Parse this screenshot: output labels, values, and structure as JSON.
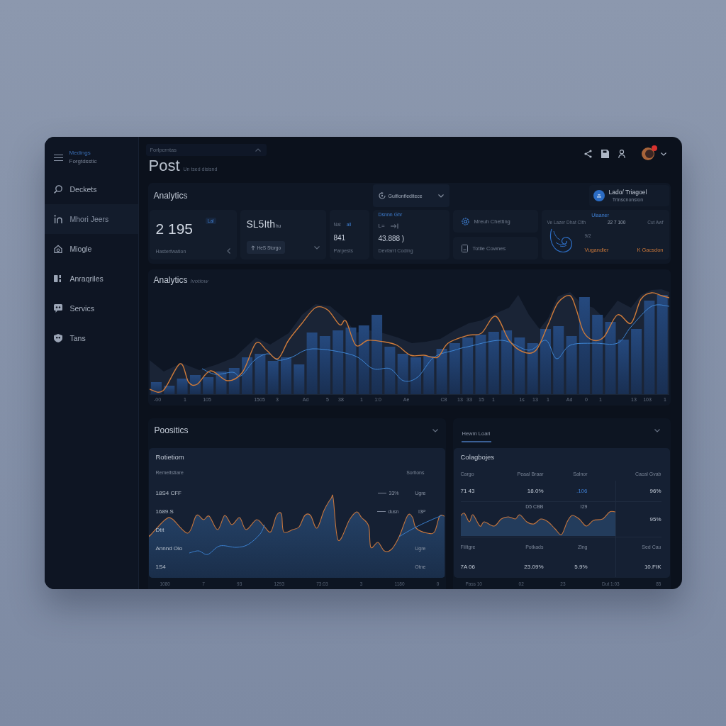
{
  "sidebar": {
    "brand": {
      "title": "Medings",
      "subtitle": "Forgtdsstic"
    },
    "items": [
      {
        "label": "Deckets",
        "selected": false
      },
      {
        "label": "Mhori Jeers",
        "selected": true
      },
      {
        "label": "Miogle",
        "selected": false
      },
      {
        "label": "Anraqriles",
        "selected": false
      },
      {
        "label": "Servics",
        "selected": false
      },
      {
        "label": "Tans",
        "selected": false
      }
    ]
  },
  "header": {
    "breadcrumb": "Forlpcrntas",
    "title": "Post",
    "subtitle": "Un tsed disisnd",
    "notification": true
  },
  "overview": {
    "title": "Analytics",
    "filter": "Guifionfieditece",
    "account": {
      "name": "Lado/ Triagoel",
      "detail": "Trlnscnonsion"
    },
    "cards": [
      {
        "kind": "metric",
        "value": "2 195",
        "badge": "Lal",
        "label": "Hasterfwation"
      },
      {
        "kind": "action",
        "value": "SL5Ith",
        "unit": "hu",
        "button": "HeS Storgo"
      },
      {
        "kind": "mini",
        "caption": "Nat",
        "tag": "all",
        "value": "841",
        "label": "Parpests"
      },
      {
        "kind": "stat",
        "heading": "Dsnnn Ghr",
        "caption": "L=",
        "value": "43.888 )",
        "label": "Devfarrt Coding"
      },
      {
        "kind": "links",
        "items": [
          {
            "label": "Mreuh Chetting"
          },
          {
            "label": "Totile Cownes"
          }
        ]
      },
      {
        "kind": "summary",
        "heading": "Ulaaner",
        "row": [
          "Ve Lazer Dhat Clth",
          "22 7 100",
          "Cut Awf"
        ],
        "caption": "9/2",
        "tags": [
          "Vugandier",
          "K Gacsdon"
        ]
      }
    ]
  },
  "trend": {
    "title": "Analytics",
    "subtitle": "Ivotiow",
    "x_labels": [
      "-00",
      "1",
      "105",
      "1505",
      "3",
      "Ad",
      "5",
      "38",
      "1",
      "1:0",
      "Ae",
      "C8",
      "13",
      "33",
      "15",
      "1",
      "1s",
      "13",
      "1",
      "Ad",
      "0",
      "1",
      "13",
      "103",
      "1"
    ]
  },
  "positions": {
    "title": "Poositics",
    "card": {
      "title": "Rotietiom",
      "header": [
        "Remeltstiare",
        "Sorllons"
      ],
      "rows": [
        {
          "label": "18S4 CFF",
          "value": "33%",
          "tag": "Ugre"
        },
        {
          "label": "1689.S",
          "value": "dusn",
          "tag": "I3P"
        },
        {
          "label": "Dtit"
        },
        {
          "label": "Annnd Oio",
          "tag": "Ugre"
        },
        {
          "label": "1S4",
          "tag": "Otne"
        }
      ]
    },
    "x_labels": [
      "1080",
      "7",
      "93",
      "1293",
      "73:03",
      "3",
      "1180",
      "0"
    ]
  },
  "categories": {
    "tabs": [
      {
        "label": "Hewm Loari",
        "selected": true
      }
    ],
    "card": {
      "title": "Colagbojes",
      "columns": [
        "Cargo",
        "Peaal Braar",
        "Salnor",
        "Cacal Gvab"
      ],
      "rows": [
        {
          "kind": "values",
          "cells": [
            {
              "text": "71 43",
              "accent": false
            },
            {
              "text": "18.0%",
              "accent": false
            },
            {
              "text": ".106",
              "accent": true
            },
            {
              "text": "96%",
              "accent": false
            }
          ]
        },
        {
          "kind": "sparkline",
          "labels": [
            "D5 CBB",
            "I29"
          ],
          "value": "95%"
        },
        {
          "kind": "header",
          "cells": [
            "Fiiltgre",
            "Potkads",
            "Zing",
            "Sed Cau"
          ]
        },
        {
          "kind": "values",
          "cells": [
            {
              "text": "7A 06",
              "accent": false
            },
            {
              "text": "23.09%",
              "accent": false
            },
            {
              "text": "5.9%",
              "accent": false
            },
            {
              "text": "10.FIK",
              "accent": false
            }
          ]
        }
      ]
    },
    "x_labels": [
      "Pass 10",
      "02",
      "23",
      "Dut 1:03",
      "85"
    ]
  }
}
